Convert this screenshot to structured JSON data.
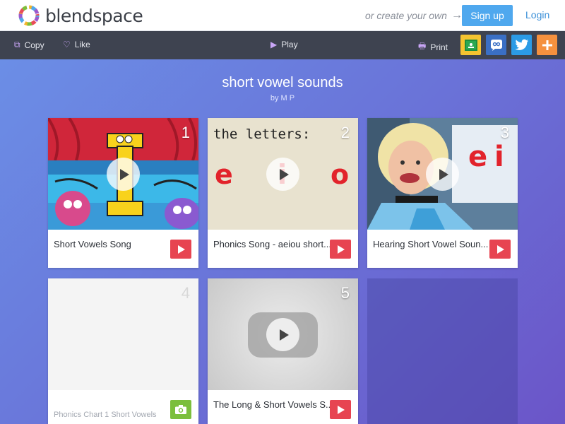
{
  "header": {
    "logo_text": "blendspace",
    "create_link": "or create your own",
    "signup_label": "Sign up",
    "login_label": "Login"
  },
  "toolbar": {
    "copy_label": "Copy",
    "like_label": "Like",
    "play_label": "Play",
    "print_label": "Print",
    "share_icons": [
      "google-classroom-icon",
      "remind-icon",
      "twitter-icon",
      "add-icon"
    ],
    "share_colors": {
      "classroom": "#1e8e3e",
      "remind": "#3a6fc4",
      "twitter": "#2b9be6",
      "add": "#f5913e"
    }
  },
  "page": {
    "title": "short vowel sounds",
    "author": "by M P"
  },
  "tiles": [
    {
      "number": "1",
      "caption": "Short Vowels Song",
      "type": "video"
    },
    {
      "number": "2",
      "caption": "Phonics Song - aeiou short...",
      "type": "video",
      "thumb_text": "the letters:",
      "thumb_letters": [
        "e",
        "i",
        "o"
      ]
    },
    {
      "number": "3",
      "caption": "Hearing Short Vowel Soun...",
      "type": "video",
      "thumb_letters": [
        "e",
        "i"
      ]
    },
    {
      "number": "4",
      "caption": "Phonics Chart 1 Short Vowels",
      "type": "image"
    },
    {
      "number": "5",
      "caption": "The Long & Short Vowels S...",
      "type": "video"
    }
  ],
  "colors": {
    "accent": "#4fa8ee",
    "video_red": "#e74451",
    "image_green": "#7bbf3c"
  }
}
